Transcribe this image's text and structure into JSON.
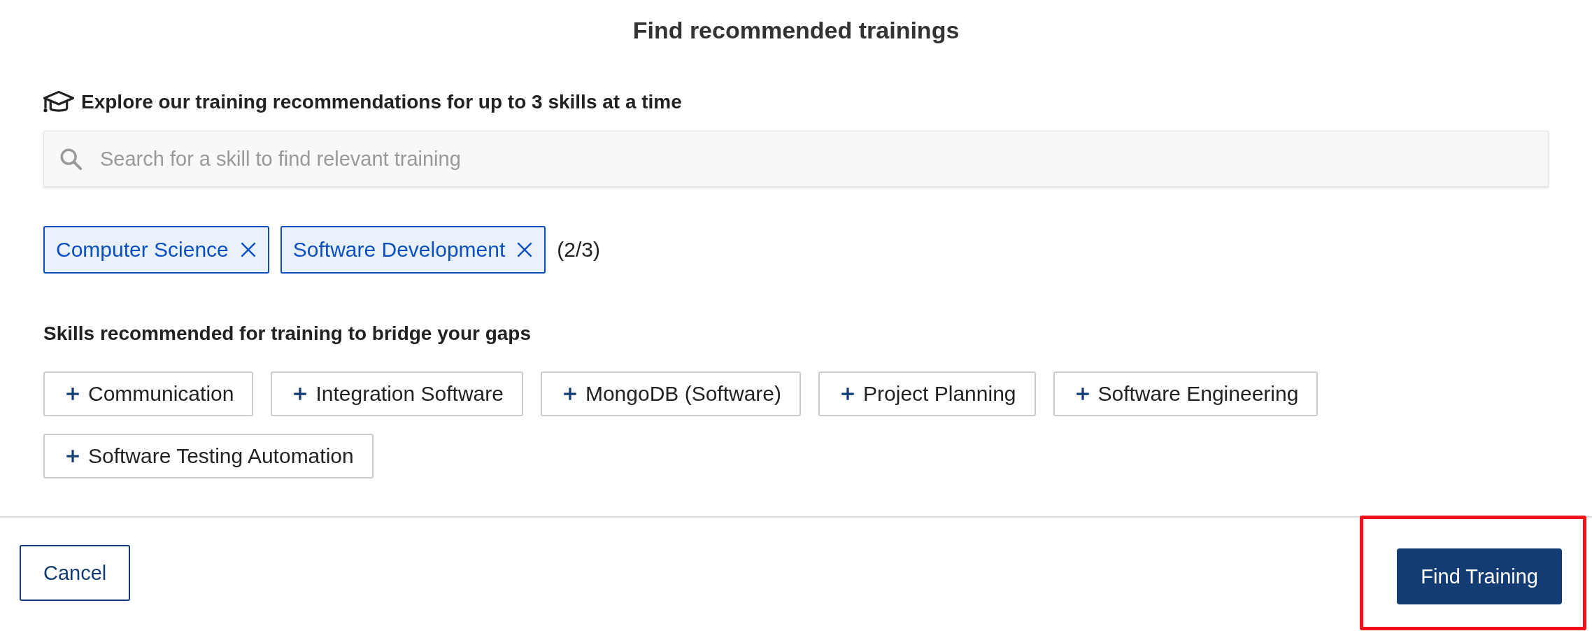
{
  "title": "Find recommended trainings",
  "explore": {
    "heading": "Explore our training recommendations for up to 3 skills at a time",
    "search": {
      "placeholder": "Search for a skill to find relevant training"
    }
  },
  "selected_skills": [
    {
      "label": "Computer Science"
    },
    {
      "label": "Software Development"
    }
  ],
  "selected_count": "(2/3)",
  "recommended": {
    "heading": "Skills recommended for training to bridge your gaps",
    "skills": [
      {
        "label": "Communication"
      },
      {
        "label": "Integration Software"
      },
      {
        "label": "MongoDB (Software)"
      },
      {
        "label": "Project Planning"
      },
      {
        "label": "Software Engineering"
      },
      {
        "label": "Software Testing Automation"
      }
    ]
  },
  "footer": {
    "cancel": "Cancel",
    "primary": {
      "label": "Find Training",
      "highlighted": true
    }
  }
}
